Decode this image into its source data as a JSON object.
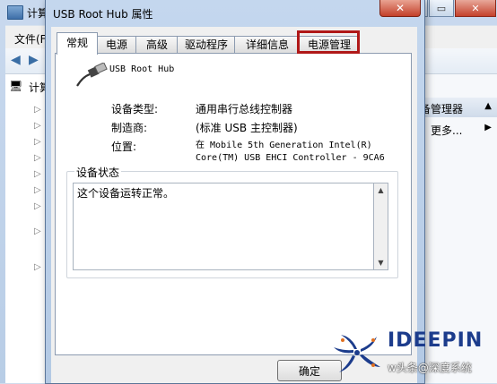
{
  "background_window": {
    "title": "计算",
    "menu_file": "文件(F",
    "tree_root_label": "计算",
    "tree_rows": [
      "▷",
      "▷",
      "▷",
      "▷",
      "▷",
      "▷",
      "▷",
      "▷",
      "▷"
    ],
    "actions_header": "备管理器",
    "more_actions": "更多..."
  },
  "dialog": {
    "title": "USB Root Hub 属性",
    "close_glyph": "✕",
    "tabs": [
      "常规",
      "电源",
      "高级",
      "驱动程序",
      "详细信息",
      "电源管理"
    ],
    "device_name": "USB Root Hub",
    "properties": [
      {
        "label": "设备类型:",
        "value": "通用串行总线控制器"
      },
      {
        "label": "制造商:",
        "value": "(标准 USB 主控制器)"
      },
      {
        "label": "位置:",
        "value_line1": "在 Mobile 5th Generation Intel(R)",
        "value_line2": "Core(TM) USB EHCI Controller - 9CA6"
      }
    ],
    "status_group_label": "设备状态",
    "status_text": "这个设备运转正常。",
    "ok_button": "确定"
  },
  "watermark": {
    "brand": "IDEEPIN",
    "credit": "w头条@深度系统"
  },
  "colors": {
    "highlight_border": "#b01818",
    "brand_blue": "#1c3c8c"
  }
}
